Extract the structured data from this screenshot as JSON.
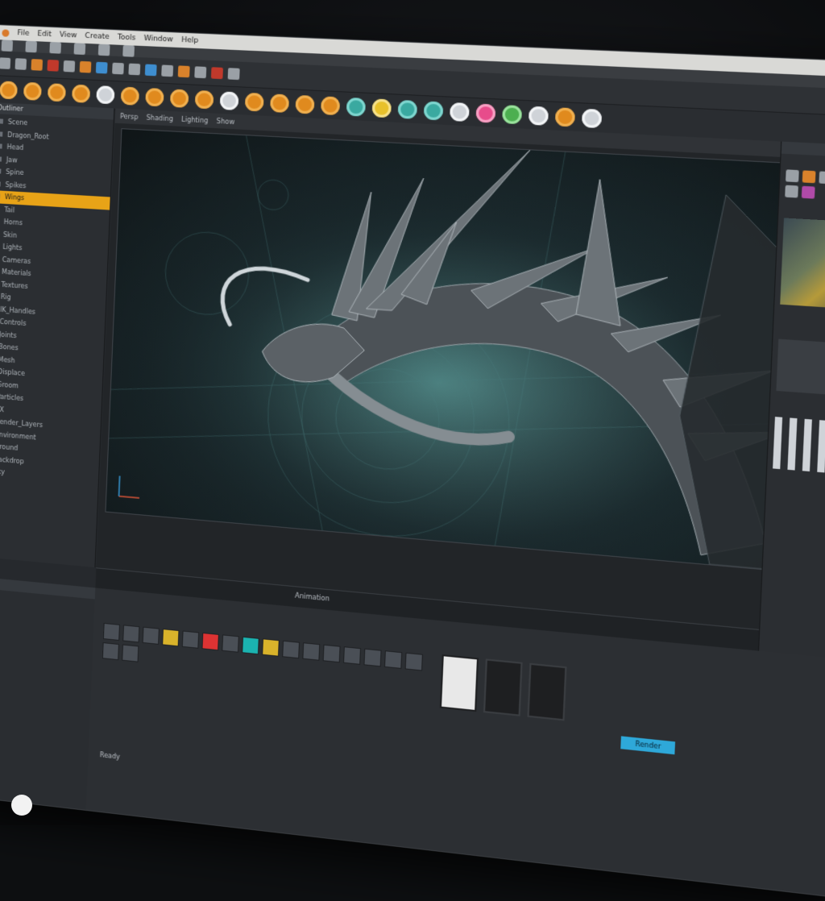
{
  "app": {
    "title_menu": [
      "File",
      "Edit",
      "View",
      "Create",
      "Tools",
      "Window",
      "Help"
    ]
  },
  "left_panel": {
    "header": "Outliner",
    "items": [
      "Scene",
      "Dragon_Root",
      "Head",
      "Jaw",
      "Spine",
      "Spikes",
      "Wings",
      "Tail",
      "Horns",
      "Skin",
      "Lights",
      "Cameras",
      "Materials",
      "Textures",
      "Rig",
      "IK_Handles",
      "Controls",
      "Joints",
      "Bones",
      "Mesh",
      "Displace",
      "Groom",
      "Particles",
      "FX",
      "Render_Layers",
      "Environment",
      "Ground",
      "Backdrop",
      "Sky"
    ],
    "selected_index": 6
  },
  "viewport": {
    "header_items": [
      "Persp",
      "Shading",
      "Lighting",
      "Show"
    ]
  },
  "timeline": {
    "label": "Animation"
  },
  "bottom": {
    "accent_button": "Render",
    "status_text": "Ready"
  },
  "colors": {
    "accent": "#e8a317",
    "highlight": "#2ea8d9",
    "icon_orange": "#e08a1e"
  }
}
